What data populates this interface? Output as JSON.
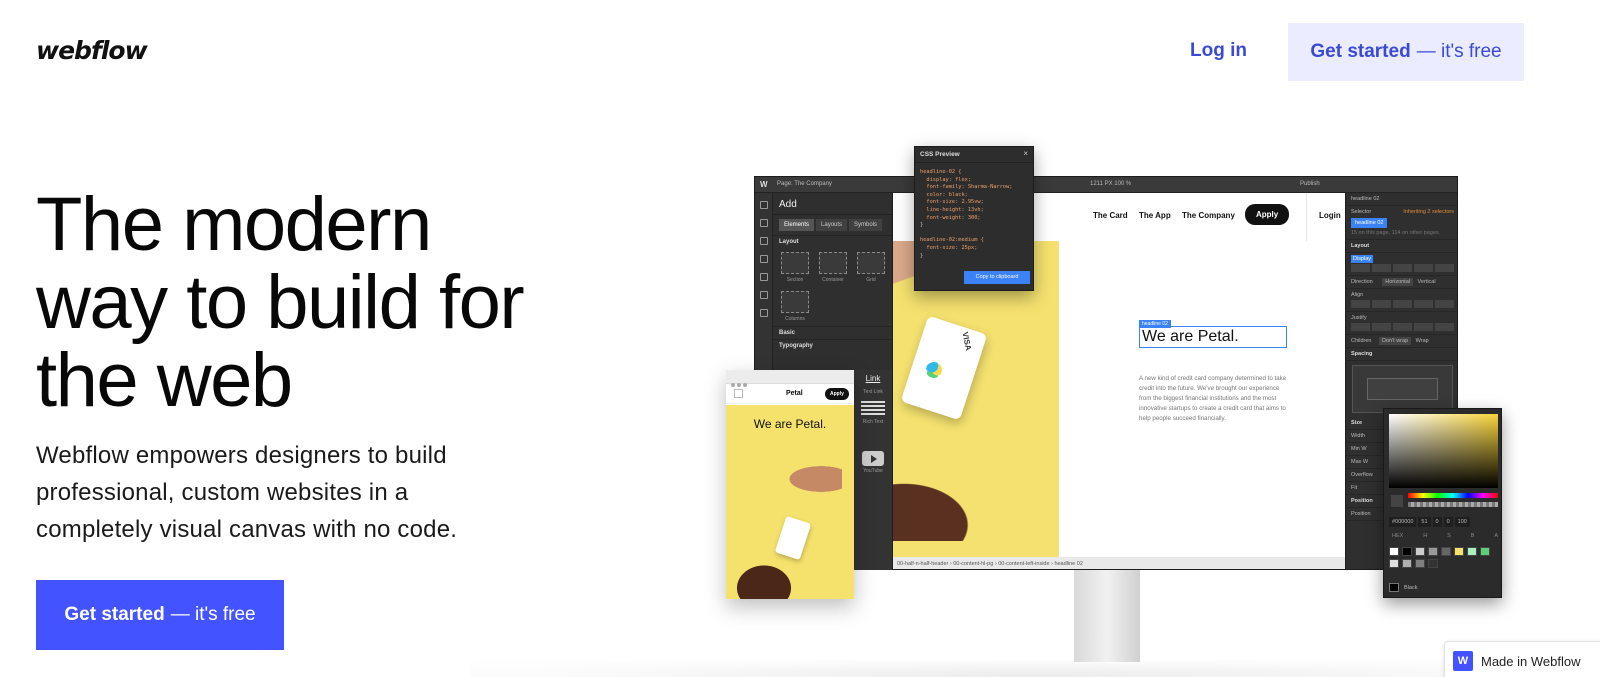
{
  "header": {
    "logo": "webflow",
    "login": "Log in",
    "cta_main": "Get started",
    "cta_sub": "— it's free"
  },
  "hero": {
    "title": "The modern way to build for the web",
    "subtitle": "Webflow empowers designers to build professional, custom websites in a completely visual canvas with no code.",
    "cta_main": "Get started",
    "cta_sub": "— it's free"
  },
  "designer": {
    "topbar": {
      "page": "Page: The Company",
      "zoom": "1211 PX  100 %",
      "publish": "Publish"
    },
    "add_panel": {
      "title": "Add",
      "tabs": [
        "Elements",
        "Layouts",
        "Symbols"
      ],
      "layout_label": "Layout",
      "layout_items": [
        "Section",
        "Container",
        "Grid",
        "Columns"
      ],
      "basic_label": "Basic",
      "typography_label": "Typography"
    },
    "site": {
      "nav": [
        "The Card",
        "The App",
        "The Company"
      ],
      "apply": "Apply",
      "login": "Login",
      "selection_label": "headline 02",
      "headline": "We are Petal.",
      "paragraph": "A new kind of credit card company determined to take credit into the future. We've brought our experience from the biggest financial institutions and the most innovative startups to create a credit card that aims to help people succeed financially.",
      "card_brand": "VISA"
    },
    "breadcrumb": "00-half-n-half-header  ›  00-content-hl-pg  ›  00-content-left-inside  ›  headline 02",
    "style_panel": {
      "element": "headline 02",
      "selector_label": "Selector",
      "inheriting": "Inheriting 2 selectors",
      "selector_value": "headline 02",
      "usage": "15 on this page, 114 on other pages.",
      "layout": "Layout",
      "display": "Display",
      "direction": "Direction",
      "horizontal": "Horizontal",
      "vertical": "Vertical",
      "align": "Align",
      "justify": "Justify",
      "children": "Children",
      "dont_wrap": "Don't wrap",
      "wrap": "Wrap",
      "spacing": "Spacing",
      "size": "Size",
      "width": "Width",
      "min_w": "Min W",
      "max_w": "Max W",
      "overflow": "Overflow",
      "fit": "Fit",
      "position_label": "Position",
      "position": "Position"
    },
    "css_preview": {
      "title": "CSS Preview",
      "code_lines": [
        "headline-02 {",
        "  display: flex;",
        "  font-family: Sharma-Narrow;",
        "  color: black;",
        "  font-size: 2.95vw;",
        "  line-height: 13vh;",
        "  font-weight: 300;",
        "}",
        "",
        "headline-02:medium {",
        "  font-size: 25px;",
        "}"
      ],
      "copy_button": "Copy to clipboard"
    },
    "mobile": {
      "brand": "Petal",
      "apply": "Apply",
      "headline": "We are Petal."
    },
    "mid_strip": {
      "link": "Link",
      "text_link": "Text Link",
      "rich_text": "Rich Text",
      "youtube": "YouTube"
    },
    "color_picker": {
      "hex": "#000000",
      "h": "51",
      "s": "0",
      "b": "0",
      "a": "100",
      "labels": [
        "HEX",
        "H",
        "S",
        "B",
        "A"
      ],
      "current": "Black",
      "swatches": [
        "#ffffff",
        "#000000",
        "#cccccc",
        "#999999",
        "#666666",
        "#f5e26c",
        "#a8f0c0",
        "#5bd07a",
        "#e0e0e0",
        "#b0b0b0",
        "#808080",
        "#333333"
      ]
    }
  },
  "badge": {
    "text": "Made in Webflow",
    "logo": "W"
  }
}
